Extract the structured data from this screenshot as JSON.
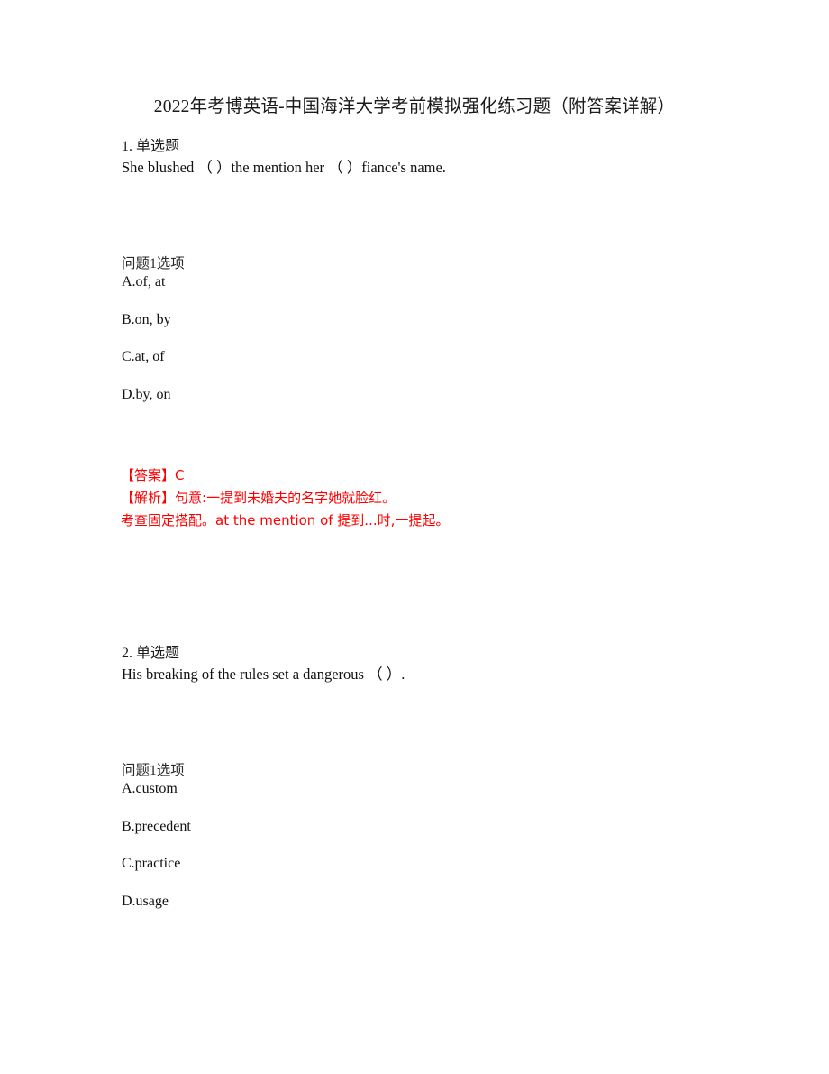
{
  "document": {
    "title": "2022年考博英语-中国海洋大学考前模拟强化练习题（附答案详解）",
    "accent_color": "#ff0000",
    "text_color": "#000000",
    "background_color": "#ffffff"
  },
  "questions": [
    {
      "number": "1. 单选题",
      "stem": "She blushed （  ）the mention her （  ）fiance's name.",
      "options_label": "问题1选项",
      "options": [
        "A.of, at",
        "B.on, by",
        "C.at, of",
        "D.by, on"
      ],
      "answer": {
        "answer_label": "【答案】",
        "answer_value": "C",
        "explanation_label": "【解析】",
        "explanation_line1": "句意:一提到未婚夫的名字她就脸红。",
        "explanation_line2": "考查固定搭配。at the mention of 提到...时,一提起。"
      }
    },
    {
      "number": "2. 单选题",
      "stem": "His breaking of the rules set a dangerous （  ）.",
      "options_label": "问题1选项",
      "options": [
        "A.custom",
        "B.precedent",
        "C.practice",
        "D.usage"
      ]
    }
  ]
}
